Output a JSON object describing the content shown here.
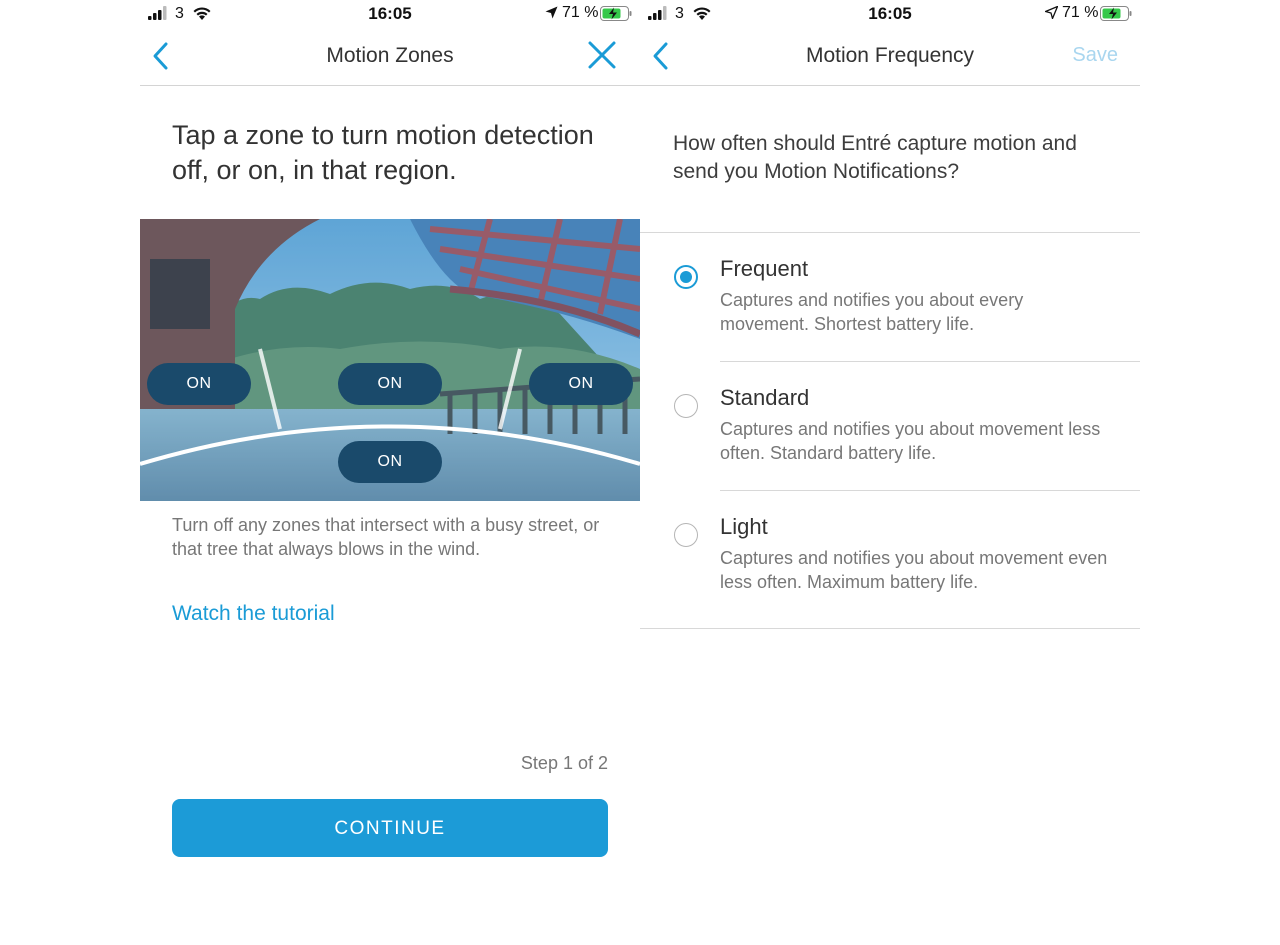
{
  "status_bar": {
    "carrier": "3",
    "time": "16:05",
    "battery_percent": "71 %"
  },
  "motion_zones": {
    "nav_title": "Motion Zones",
    "heading": "Tap a zone to turn motion detection off, or on, in that region.",
    "zones": [
      {
        "label": "ON",
        "state": "on"
      },
      {
        "label": "ON",
        "state": "on"
      },
      {
        "label": "ON",
        "state": "on"
      },
      {
        "label": "ON",
        "state": "on"
      }
    ],
    "hint": "Turn off any zones that intersect with a busy street, or that tree that always blows in the wind.",
    "tutorial_link": "Watch the tutorial",
    "step": "Step 1 of 2",
    "continue_label": "CONTINUE"
  },
  "motion_frequency": {
    "nav_title": "Motion Frequency",
    "save_label": "Save",
    "question": "How often should Entré capture motion and send you Motion Notifications?",
    "selected": "Frequent",
    "options": [
      {
        "title": "Frequent",
        "description": "Captures and notifies you about every movement. Shortest battery life."
      },
      {
        "title": "Standard",
        "description": "Captures and notifies you about movement less often. Standard battery life."
      },
      {
        "title": "Light",
        "description": "Captures and notifies you about movement even less often. Maximum battery life."
      }
    ]
  },
  "colors": {
    "accent": "#1a9bd6",
    "button": "#1c9bd7",
    "zone_button": "#1a4a6b",
    "save_disabled": "#a9d6ef"
  }
}
